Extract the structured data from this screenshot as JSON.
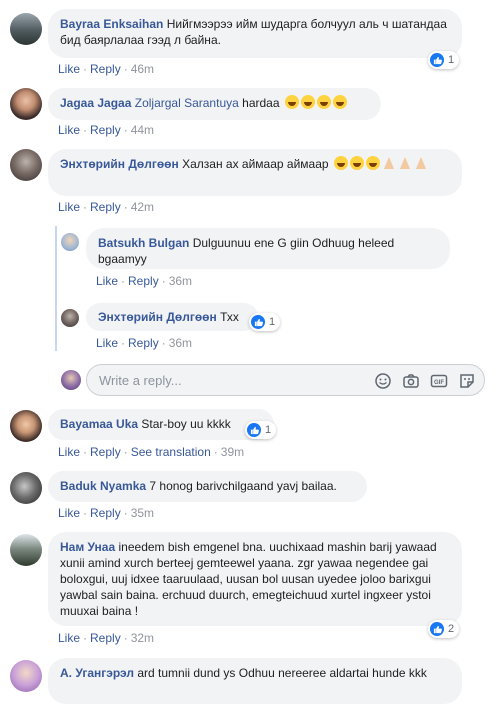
{
  "comments": [
    {
      "author": "Bayraa Enksaihan",
      "text": "Нийгмээрээ ийм шударга болчуул аль ч шатандаа бид баярлалаа гээд л байна.",
      "like": "Like",
      "reply": "Reply",
      "time": "46m",
      "reactions": "1"
    },
    {
      "author": "Jagaa Jagaa",
      "tag": "Zoljargal Sarantuya",
      "text": "hardaa",
      "like": "Like",
      "reply": "Reply",
      "time": "44m"
    },
    {
      "author": "Энхтөрийн Дөлгөөн",
      "text": "Халзан ах аймаар аймаар",
      "like": "Like",
      "reply": "Reply",
      "time": "42m"
    },
    {
      "author": "Bayamaa Uka",
      "text": "Star-boy uu kkkk",
      "like": "Like",
      "reply": "Reply",
      "see_translation": "See translation",
      "time": "39m",
      "reactions": "1"
    },
    {
      "author": "Baduk Nyamka",
      "text": "7 honog barivchilgaand yavj bailaa.",
      "like": "Like",
      "reply": "Reply",
      "time": "35m"
    },
    {
      "author": "Нам Унаа",
      "text": "ineedem bish emgenel bna. uuchixaad mashin barij yawaad xunii amind xurch berteej gemteewel yaana. zgr yawaa negendee gai boloxgui, uuj idxee taaruulaad, uusan bol uusan uyedee joloo barixgui yawbal sain baina. erchuud duurch, emegteichuud xurtel ingxeer ystoi muuxai baina !",
      "like": "Like",
      "reply": "Reply",
      "time": "32m",
      "reactions": "2"
    },
    {
      "author": "А. Угангэрэл",
      "text": "ard tumnii dund ys Odhuu nereeree aldartai hunde kkk"
    }
  ],
  "replies": [
    {
      "author": "Batsukh Bulgan",
      "text": "Dulguunuu ene G giin Odhuug heleed bgaamyy",
      "like": "Like",
      "reply": "Reply",
      "time": "36m"
    },
    {
      "author": "Энхтөрийн Дөлгөөн",
      "text": "Тхх",
      "like": "Like",
      "reply": "Reply",
      "time": "36m",
      "reactions": "1"
    }
  ],
  "composer": {
    "placeholder": "Write a reply..."
  },
  "icons": [
    "smiley-icon",
    "camera-icon",
    "gif-icon",
    "sticker-icon",
    "like-icon"
  ],
  "colors": {
    "link": "#385898",
    "bubble": "#f2f3f5",
    "meta": "#90949c",
    "like": "#1877f2"
  }
}
